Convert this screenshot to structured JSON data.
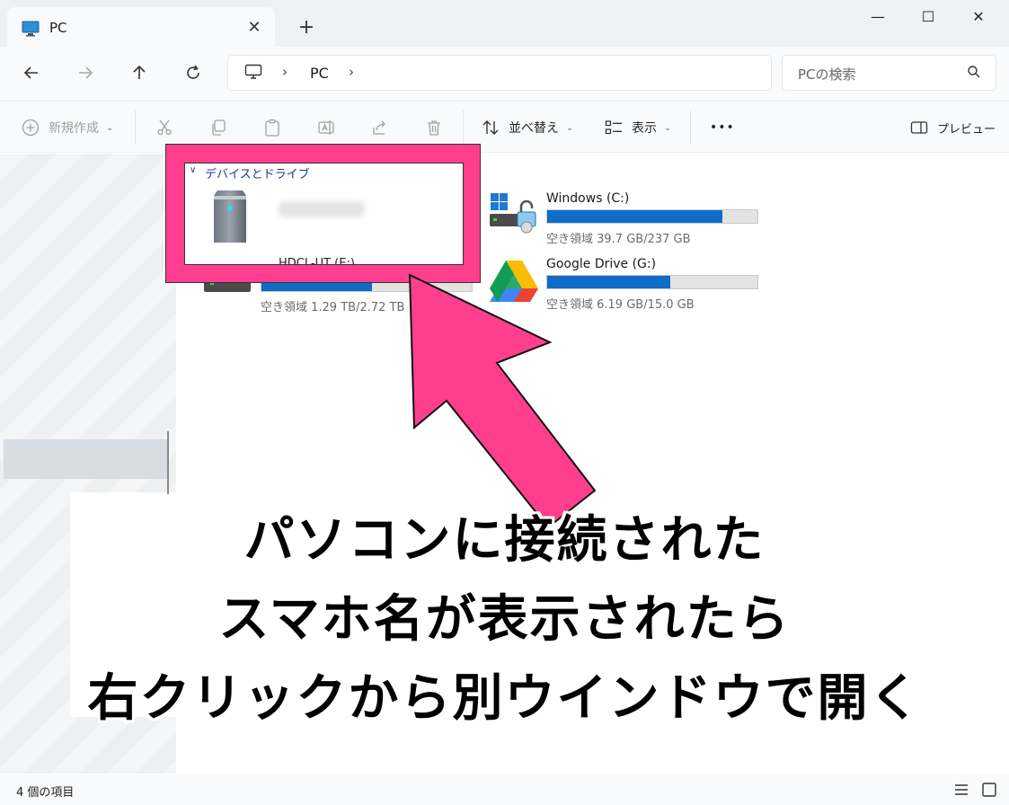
{
  "window": {
    "tab_title": "PC",
    "tab_close": "✕",
    "new_tab": "+",
    "minimize": "—",
    "maximize": "☐",
    "close": "✕"
  },
  "nav": {
    "address_separator": "›",
    "address_location": "PC",
    "search_placeholder": "PCの検索"
  },
  "toolbar": {
    "new_label": "新規作成",
    "sort_label": "並べ替え",
    "view_label": "表示",
    "more_label": "•••",
    "preview_label": "プレビュー"
  },
  "content": {
    "group_label": "デバイスとドライブ",
    "device_name_peek": "HDCL-UT (E:)",
    "drives": [
      {
        "name": "Windows (C:)",
        "free_text": "空き領域 39.7 GB/237 GB",
        "used_fraction": 0.833
      },
      {
        "name": "Google Drive (G:)",
        "free_text": "空き領域 6.19 GB/15.0 GB",
        "used_fraction": 0.587
      },
      {
        "name": "HDCL-UT (E:)",
        "free_text": "空き領域 1.29 TB/2.72 TB",
        "used_fraction": 0.526
      }
    ]
  },
  "caption": {
    "line1": "パソコンに接続された",
    "line2": "スマホ名が表示されたら",
    "line3": "右クリックから別ウインドウで開く"
  },
  "status": {
    "item_count": "4 個の項目"
  },
  "colors": {
    "highlight": "#ff3f8e",
    "drive_fill": "#0f6cc9"
  }
}
